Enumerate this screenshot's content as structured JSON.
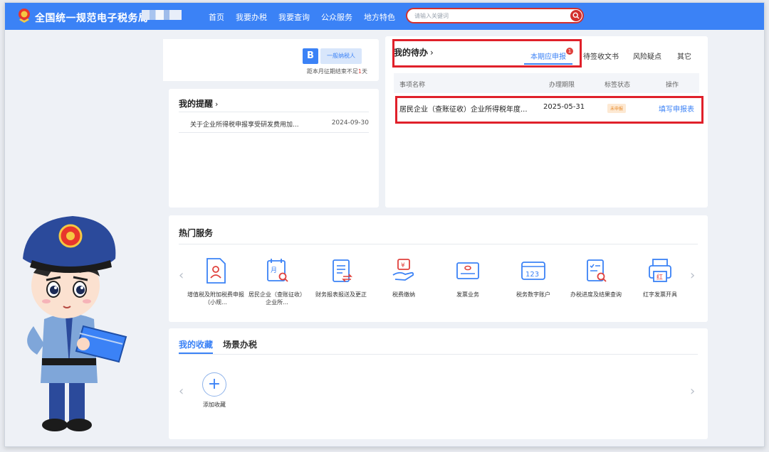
{
  "header": {
    "site_title": "全国统一规范电子税务局",
    "nav": [
      "首页",
      "我要办税",
      "我要查询",
      "公众服务",
      "地方特色"
    ],
    "search_placeholder": "请输入关键词"
  },
  "taxpayer": {
    "badge_letter": "B",
    "taxpayer_type": "一般纳税人",
    "deadline_prefix": "距本月征期结束不足",
    "deadline_days": "1",
    "deadline_unit": "天"
  },
  "reminders": {
    "title": "我的提醒",
    "items": [
      {
        "text": "关于企业所得税申报享受研发费用加...",
        "date": "2024-09-30"
      }
    ]
  },
  "todo": {
    "title": "我的待办",
    "tabs": [
      "本期应申报",
      "待签收文书",
      "风险疑点",
      "其它"
    ],
    "active_tab_count": "1",
    "columns": [
      "事项名称",
      "办理期限",
      "标签状态",
      "操作"
    ],
    "rows": [
      {
        "name": "居民企业（查账征收）企业所得税年度...",
        "deadline": "2025-05-31",
        "status": "未申报",
        "action": "填写申报表"
      }
    ]
  },
  "hot_services": {
    "title": "热门服务",
    "items": [
      {
        "label": "增值税及附加税费申报（小规...",
        "icon": "person-document-icon"
      },
      {
        "label": "居民企业（查账征收）企业所...",
        "icon": "calendar-search-icon"
      },
      {
        "label": "财务报表报送及更正",
        "icon": "report-exchange-icon"
      },
      {
        "label": "税费缴纳",
        "icon": "hand-payment-icon"
      },
      {
        "label": "发票业务",
        "icon": "invoice-icon"
      },
      {
        "label": "税务数字账户",
        "icon": "digital-account-icon"
      },
      {
        "label": "办税进度及结果查询",
        "icon": "progress-search-icon"
      },
      {
        "label": "红字发票开具",
        "icon": "red-invoice-printer-icon"
      }
    ]
  },
  "favorites": {
    "tabs": [
      "我的收藏",
      "场景办税"
    ],
    "add_label": "添加收藏"
  },
  "colors": {
    "primary": "#3b82f6",
    "highlight_red": "#e0202a",
    "search_red": "#d2302d"
  }
}
